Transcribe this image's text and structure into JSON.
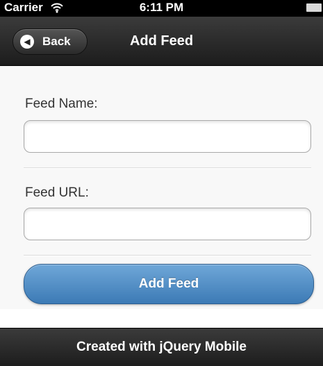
{
  "status_bar": {
    "carrier": "Carrier",
    "time": "6:11 PM",
    "wifi_icon": "wifi-icon",
    "battery_icon": "battery-icon"
  },
  "header": {
    "back_label": "Back",
    "back_icon": "arrow-left-icon",
    "title": "Add Feed"
  },
  "form": {
    "feed_name_label": "Feed Name:",
    "feed_name_value": "",
    "feed_url_label": "Feed URL:",
    "feed_url_value": "",
    "submit_label": "Add Feed"
  },
  "footer": {
    "text": "Created with jQuery Mobile"
  },
  "colors": {
    "bar_dark": "#1c1c1c",
    "button_blue": "#3c7ab5",
    "content_bg": "#f8f8f8"
  }
}
